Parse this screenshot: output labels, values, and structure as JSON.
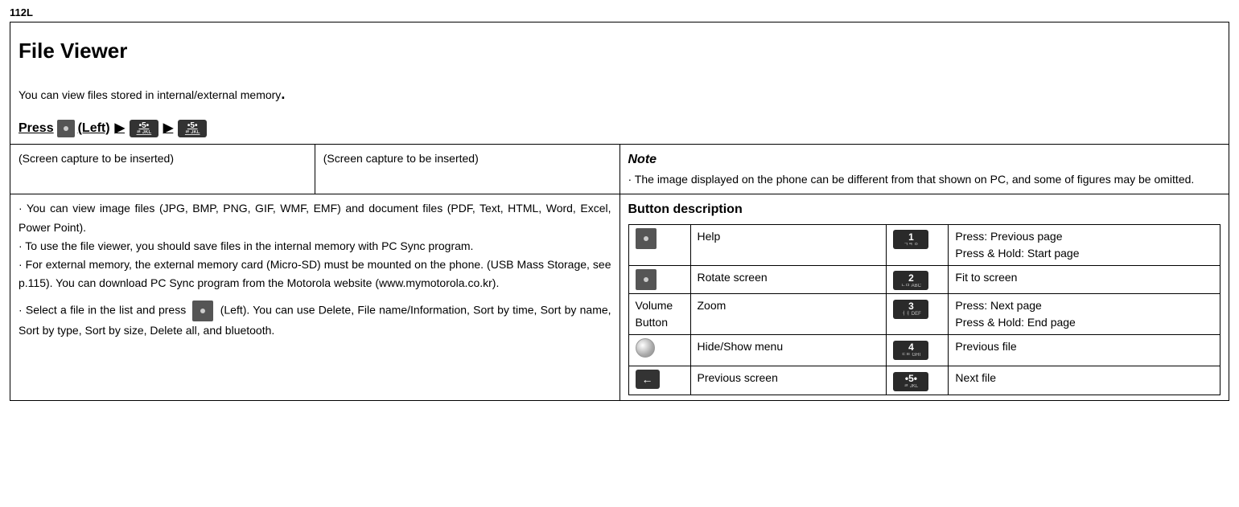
{
  "page_number": "112L",
  "header": {
    "title": "File Viewer",
    "intro": "You can view files stored in internal/external memory",
    "press_label": "Press",
    "press_left": "(Left)"
  },
  "row2": {
    "cell1": "(Screen capture to be inserted)",
    "cell2": "(Screen capture to be inserted)",
    "note_title": "Note",
    "note_body": "· The image displayed on the phone can be different from that shown on PC, and some of figures may be omitted."
  },
  "row3": {
    "left_p1": "· You can view image files (JPG, BMP, PNG, GIF, WMF, EMF) and document files (PDF, Text, HTML, Word, Excel, Power Point).",
    "left_p2": "· To use the file viewer, you should save files in the internal memory with PC Sync program.",
    "left_p3": "· For external memory, the external memory card (Micro-SD) must be mounted on the phone. (USB Mass Storage, see p.115). You can download PC Sync program from the Motorola website (www.mymotorola.co.kr).",
    "left_p4a": "· Select a file in the list and press",
    "left_p4b": "(Left). You can use Delete, File name/Information, Sort by time, Sort by name, Sort by type, Sort by size, Delete all, and bluetooth.",
    "btn_title": "Button description",
    "buttons": [
      {
        "left_label": "Help",
        "right_label": "Press: Previous page\nPress & Hold: Start page",
        "rn": "1",
        "rs": "ㄱㅋ ㅇ"
      },
      {
        "left_label": "Rotate screen",
        "right_label": "Fit to screen",
        "rn": "2",
        "rs": "ㄴㅁ ABC"
      },
      {
        "left_icon_text": "Volume Button",
        "left_label": "Zoom",
        "right_label": "Press: Next page\nPress & Hold: End page",
        "rn": "3",
        "rs": "ㅓㅕ DEF"
      },
      {
        "left_label": "Hide/Show menu",
        "right_label": "Previous file",
        "rn": "4",
        "rs": "ㄷㅌ GHI"
      },
      {
        "left_label": "Previous screen",
        "right_label": "Next file",
        "rn": "5",
        "rs": "ㄹ JKL"
      }
    ]
  }
}
